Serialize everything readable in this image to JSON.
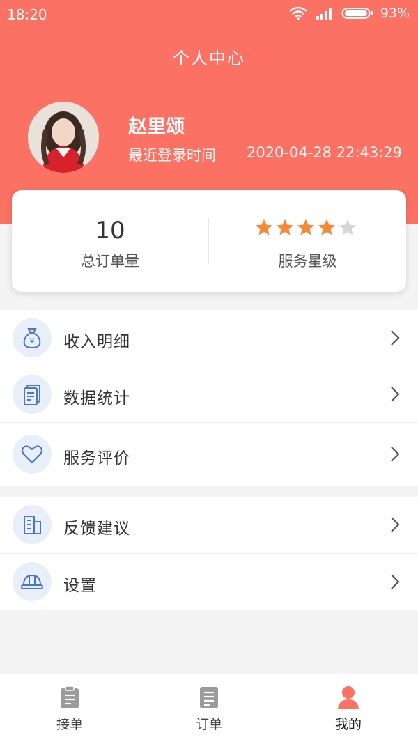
{
  "status_bar": {
    "time": "18:20",
    "battery": "93%"
  },
  "header": {
    "title": "个人中心"
  },
  "profile": {
    "name": "赵里颂",
    "login_label": "最近登录时间",
    "login_time": "2020-04-28 22:43:29"
  },
  "stats": {
    "order_count": "10",
    "order_label": "总订单量",
    "rating": 4,
    "rating_max": 5,
    "rating_label": "服务星级"
  },
  "menu": {
    "group1": [
      {
        "label": "收入明细",
        "icon": "money-bag-icon"
      },
      {
        "label": "数据统计",
        "icon": "document-icon"
      },
      {
        "label": "服务评价",
        "icon": "heart-icon"
      }
    ],
    "group2": [
      {
        "label": "反馈建议",
        "icon": "building-icon"
      },
      {
        "label": "设置",
        "icon": "helmet-icon"
      }
    ]
  },
  "tabbar": [
    {
      "label": "接单",
      "icon": "clipboard-icon"
    },
    {
      "label": "订单",
      "icon": "list-icon"
    },
    {
      "label": "我的",
      "icon": "person-icon"
    }
  ],
  "colors": {
    "brand": "#fb7264",
    "star": "#f5883b",
    "star_empty": "#d6d6d6",
    "icon_blue": "#4a78c8"
  }
}
